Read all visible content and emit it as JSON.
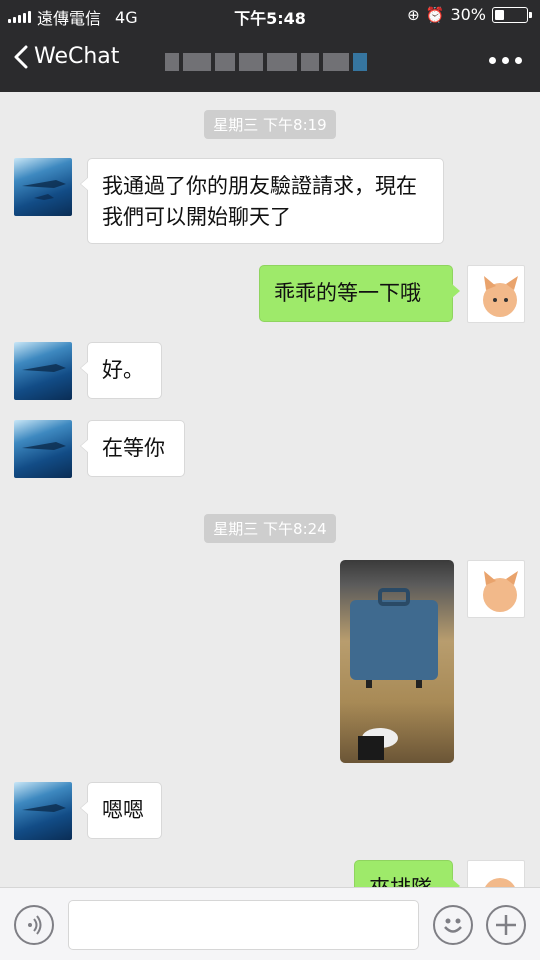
{
  "status_bar": {
    "carrier": "遠傳電信",
    "network": "4G",
    "time": "下午5:48",
    "battery_percent": "30%",
    "battery_level": 0.3
  },
  "nav": {
    "back_label": "WeChat"
  },
  "messages": {
    "ts1": "星期三 下午8:19",
    "m1": "我通過了你的朋友驗證請求，現在我們可以開始聊天了",
    "m2": "乖乖的等一下哦",
    "m3": "好。",
    "m4": "在等你",
    "ts2": "星期三 下午8:24",
    "m5": "嗯嗯",
    "m6": "來排隊"
  },
  "colors": {
    "outgoing_bubble": "#9eea6a",
    "incoming_bubble": "#ffffff",
    "nav_bg": "#2b2b2d",
    "chat_bg": "#ebebeb"
  }
}
